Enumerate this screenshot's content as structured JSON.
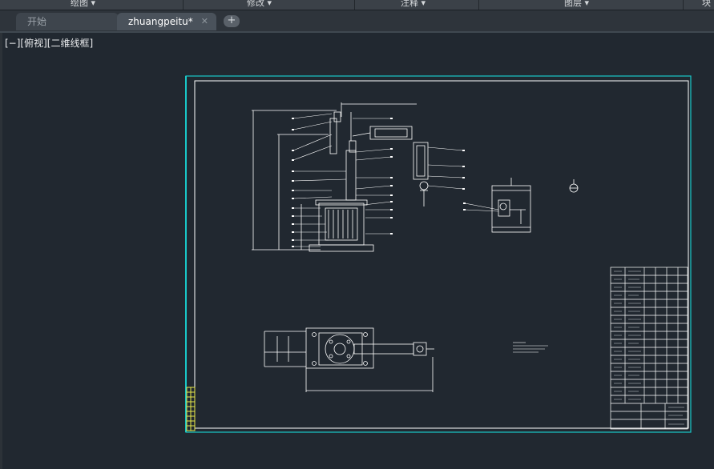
{
  "ribbon": {
    "sections": [
      {
        "label": "绘图",
        "arrow": "▾"
      },
      {
        "label": "修改",
        "arrow": "▾"
      },
      {
        "label": "注释",
        "arrow": "▾"
      },
      {
        "label": "图层",
        "arrow": "▾"
      },
      {
        "label": "块"
      }
    ]
  },
  "tabs": [
    {
      "label": "开始",
      "active": false
    },
    {
      "label": "zhuangpeitu*",
      "active": true,
      "close": "✕"
    }
  ],
  "new_tab": "+",
  "viewport": {
    "label": "[−][俯视][二维线框]"
  },
  "colors": {
    "background": "#212830",
    "sheet_border": "#19c8c8",
    "linework": "#ffffff",
    "title_block_yellow": "#e8e84a"
  },
  "icons": [
    "chevron-down-icon",
    "close-icon",
    "plus-icon"
  ]
}
